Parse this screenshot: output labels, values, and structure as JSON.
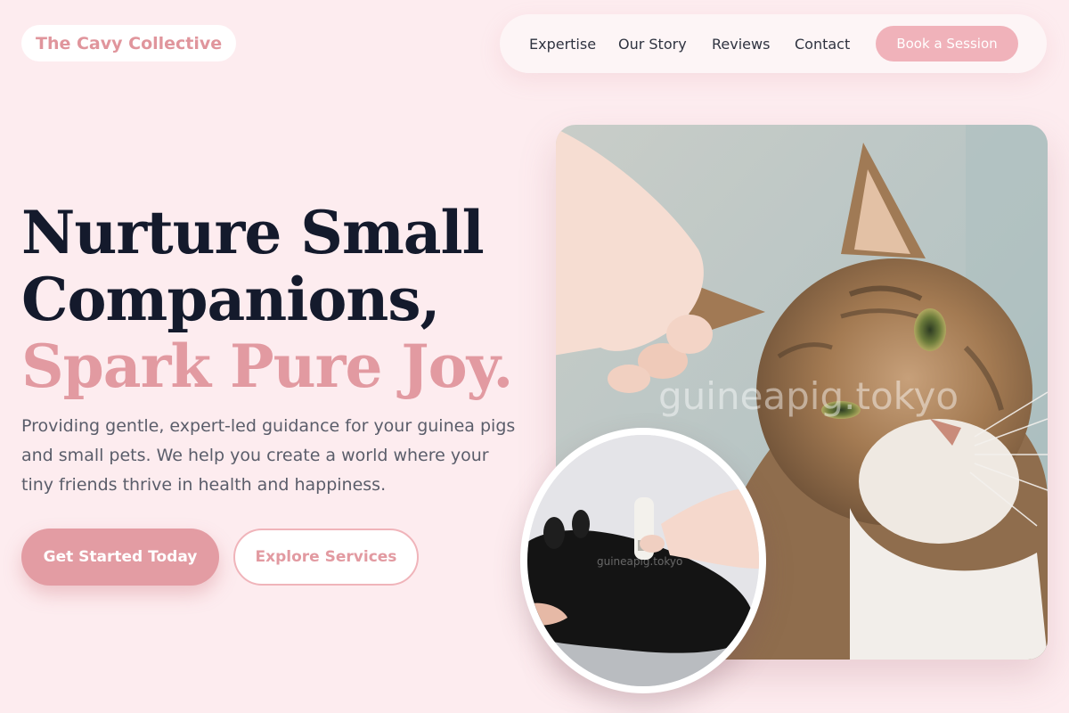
{
  "brand": {
    "name": "The Cavy Collective"
  },
  "nav": {
    "links": [
      "Expertise",
      "Our Story",
      "Reviews",
      "Contact"
    ],
    "cta_label": "Book a Session"
  },
  "hero": {
    "title_line1": "Nurture Small",
    "title_line2": "Companions,",
    "title_accent": "Spark Pure Joy.",
    "description": "Providing gentle, expert-led guidance for your guinea pigs and small pets. We help you create a world where your tiny friends thrive in health and happiness.",
    "primary_button": "Get Started Today",
    "secondary_button": "Explore Services"
  },
  "images": {
    "main_watermark": "guineapig.tokyo",
    "inset_watermark": "guineapig.tokyo"
  },
  "colors": {
    "background": "#fdecef",
    "accent": "#e29aa1",
    "heading": "#141a2c",
    "nav_cta": "#f0b2ba"
  }
}
